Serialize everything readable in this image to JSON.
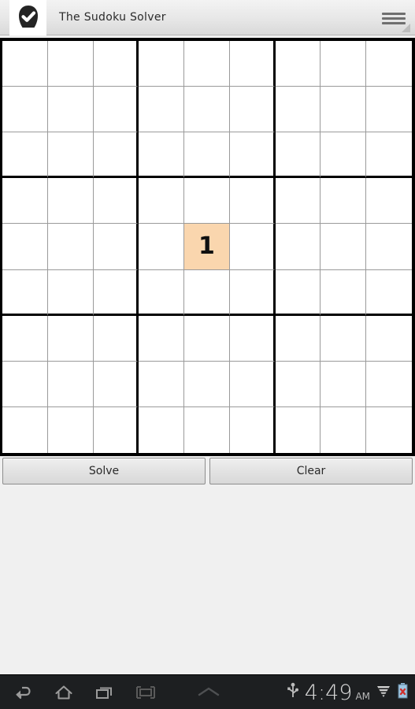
{
  "app": {
    "title": "The Sudoku Solver",
    "icon": "check-badge-icon",
    "menu_icon": "hamburger-menu-icon"
  },
  "board": {
    "size": 9,
    "selected_cell": {
      "row": 5,
      "col": 5,
      "value": "1"
    },
    "selected_bg": "#fad6ae",
    "grid_line_color": "#9a9a9a",
    "box_line_color": "#000000",
    "cells": [
      [
        "",
        "",
        "",
        "",
        "",
        "",
        "",
        "",
        ""
      ],
      [
        "",
        "",
        "",
        "",
        "",
        "",
        "",
        "",
        ""
      ],
      [
        "",
        "",
        "",
        "",
        "",
        "",
        "",
        "",
        ""
      ],
      [
        "",
        "",
        "",
        "",
        "",
        "",
        "",
        "",
        ""
      ],
      [
        "",
        "",
        "",
        "",
        "1",
        "",
        "",
        "",
        ""
      ],
      [
        "",
        "",
        "",
        "",
        "",
        "",
        "",
        "",
        ""
      ],
      [
        "",
        "",
        "",
        "",
        "",
        "",
        "",
        "",
        ""
      ],
      [
        "",
        "",
        "",
        "",
        "",
        "",
        "",
        "",
        ""
      ],
      [
        "",
        "",
        "",
        "",
        "",
        "",
        "",
        "",
        ""
      ]
    ]
  },
  "actions": {
    "solve_label": "Solve",
    "clear_label": "Clear"
  },
  "navbar": {
    "back_icon": "back-arrow-icon",
    "home_icon": "home-icon",
    "recents_icon": "recent-apps-icon",
    "screenshot_icon": "screenshot-icon",
    "expand_icon": "chevron-up-icon",
    "usb_icon": "usb-icon",
    "clock_time": "4:49",
    "clock_ampm": "AM",
    "signal_icon": "signal-icon",
    "battery_icon": "battery-error-icon"
  }
}
